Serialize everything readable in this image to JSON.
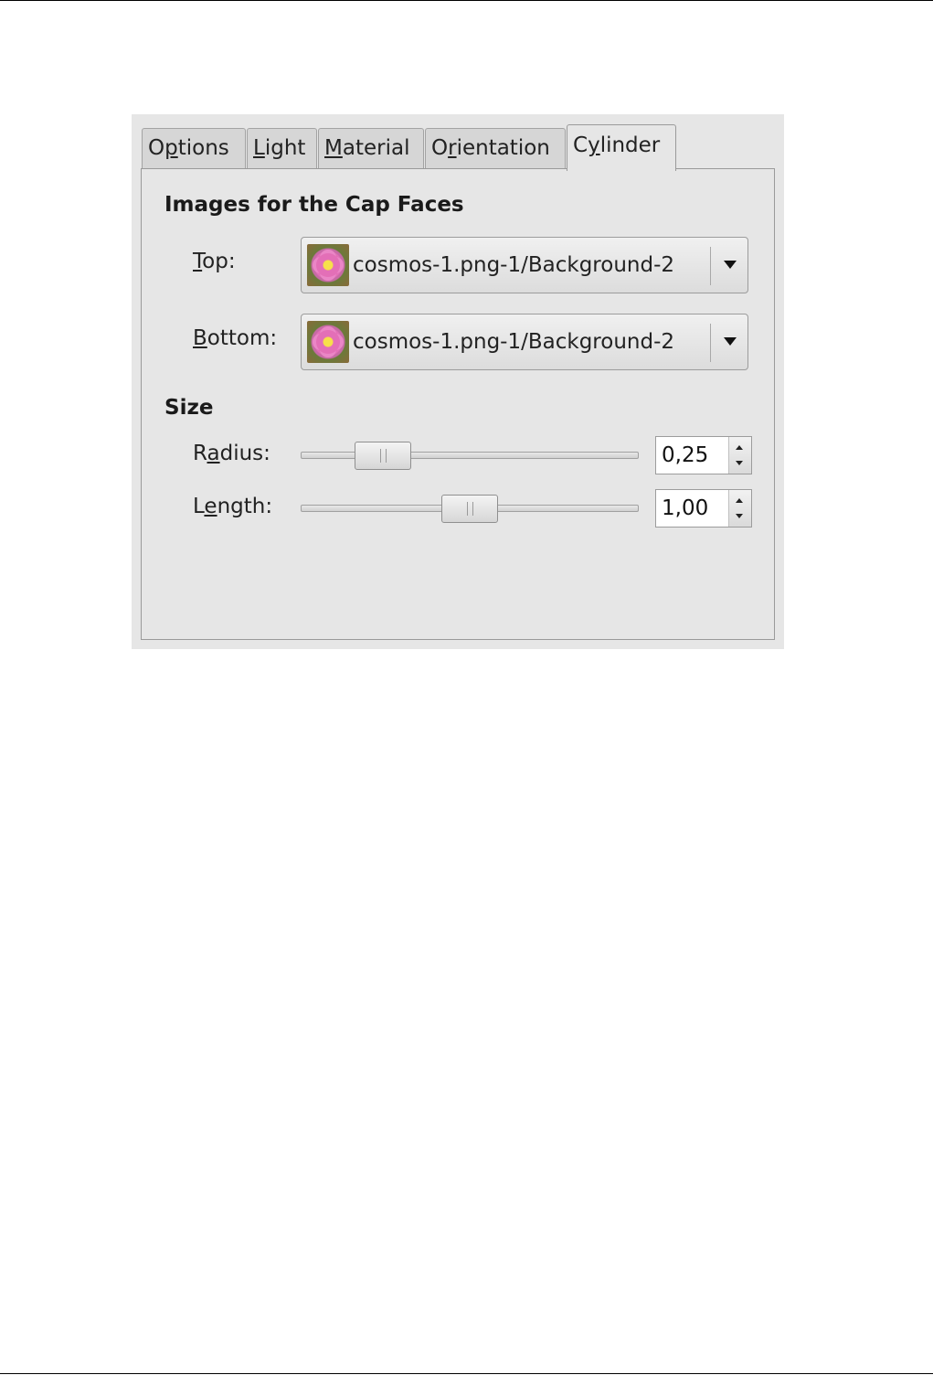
{
  "tabs": {
    "options": {
      "pre": "O",
      "u": "p",
      "post": "tions"
    },
    "light": {
      "pre": "",
      "u": "L",
      "post": "ight"
    },
    "material": {
      "pre": "",
      "u": "M",
      "post": "aterial"
    },
    "orientation": {
      "pre": "O",
      "u": "r",
      "post": "ientation"
    },
    "cylinder": {
      "pre": "C",
      "u": "y",
      "post": "linder"
    },
    "active": "Cylinder"
  },
  "cap_faces": {
    "title": "Images for the Cap Faces",
    "top": {
      "label_u": "T",
      "label_rest": "op:",
      "value": "cosmos-1.png-1/Background-2",
      "icon": "flower-thumbnail-icon"
    },
    "bottom": {
      "label_u": "B",
      "label_rest": "ottom:",
      "value": "cosmos-1.png-1/Background-2",
      "icon": "flower-thumbnail-icon"
    }
  },
  "size": {
    "title": "Size",
    "radius": {
      "label_pre": "R",
      "label_u": "a",
      "label_post": "dius:",
      "value": "0,25",
      "slider_fraction": 0.19
    },
    "length": {
      "label_pre": "L",
      "label_u": "e",
      "label_post": "ngth:",
      "value": "1,00",
      "slider_fraction": 0.5
    }
  },
  "colors": {
    "background": "#e6e6e6",
    "border": "#9a9a9a"
  }
}
